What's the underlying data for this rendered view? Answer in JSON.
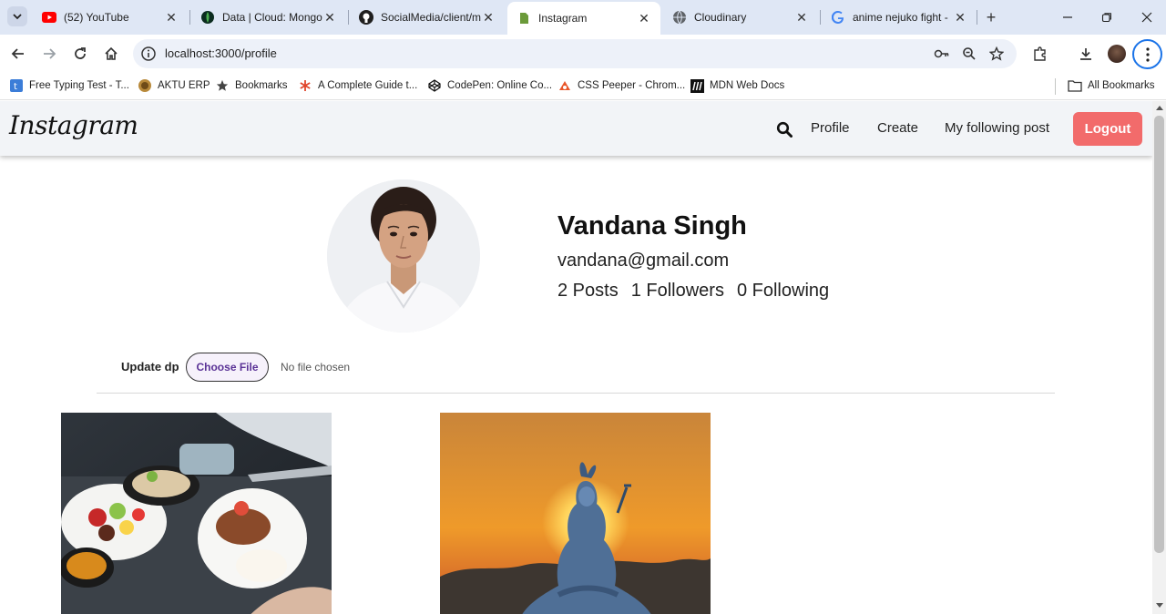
{
  "browser": {
    "tabs": [
      {
        "title": "(52) YouTube",
        "favicon": "youtube-icon",
        "active": false
      },
      {
        "title": "Data | Cloud: MongoDB",
        "favicon": "mongodb-icon",
        "active": false
      },
      {
        "title": "SocialMedia/client/m",
        "favicon": "github-icon",
        "active": false
      },
      {
        "title": "Instagram",
        "favicon": "page-icon",
        "active": true
      },
      {
        "title": "Cloudinary",
        "favicon": "globe-icon",
        "active": false
      },
      {
        "title": "anime nejuko fight -",
        "favicon": "google-icon",
        "active": false
      }
    ],
    "url": "localhost:3000/profile",
    "bookmarks": [
      {
        "label": "Free Typing Test - T...",
        "icon": "typing-icon"
      },
      {
        "label": "AKTU ERP",
        "icon": "aktu-icon"
      },
      {
        "label": "Bookmarks",
        "icon": "star-icon"
      },
      {
        "label": "A Complete Guide t...",
        "icon": "asterisk-icon"
      },
      {
        "label": "CodePen: Online Co...",
        "icon": "codepen-icon"
      },
      {
        "label": "CSS Peeper - Chrom...",
        "icon": "csspeeper-icon"
      },
      {
        "label": "MDN Web Docs",
        "icon": "mdn-icon"
      }
    ],
    "all_bookmarks": "All Bookmarks"
  },
  "app": {
    "logo": "Instagram",
    "nav": {
      "profile": "Profile",
      "create": "Create",
      "following": "My following post",
      "logout": "Logout"
    },
    "profile": {
      "name": "Vandana Singh",
      "email": "vandana@gmail.com",
      "posts": "2 Posts",
      "followers": "1 Followers",
      "following": "0 Following"
    },
    "update_dp": {
      "label": "Update dp",
      "button": "Choose File",
      "status": "No file chosen"
    }
  },
  "colors": {
    "logout_bg": "#f26b6b",
    "tabstrip_bg": "#dfe7f5",
    "navbar_bg": "#f2f4f7",
    "choose_file_text": "#5a3296"
  }
}
